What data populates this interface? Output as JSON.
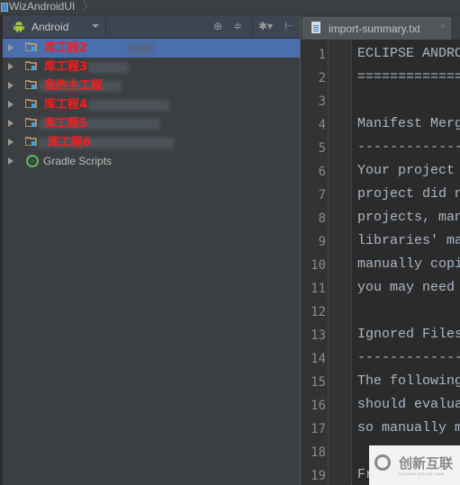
{
  "window": {
    "title": "WizAndroidUI"
  },
  "project_panel": {
    "view_selector": "Android",
    "toolbar_icons": [
      "crosshair-icon",
      "collapse-all-icon",
      "gear-icon",
      "hide-panel-icon"
    ],
    "items": [
      {
        "label": "库工程2",
        "type": "module",
        "selected": true
      },
      {
        "label": "库工程3",
        "type": "module",
        "selected": false
      },
      {
        "label": "我的主工程",
        "type": "module",
        "selected": false
      },
      {
        "label": "库工程4",
        "type": "module",
        "selected": false
      },
      {
        "label": "库工程5",
        "type": "module",
        "selected": false
      },
      {
        "label": "库工程6",
        "type": "module",
        "selected": false
      },
      {
        "label": "Gradle Scripts",
        "type": "gradle",
        "selected": false
      }
    ]
  },
  "editor": {
    "tab": {
      "label": "import-summary.txt",
      "close": "×"
    },
    "lines": [
      {
        "n": "1",
        "text": "ECLIPSE ANDRO"
      },
      {
        "n": "2",
        "text": "============="
      },
      {
        "n": "3",
        "text": ""
      },
      {
        "n": "4",
        "text": "Manifest Merg"
      },
      {
        "n": "5",
        "text": "-------------"
      },
      {
        "n": "6",
        "text": "Your project "
      },
      {
        "n": "7",
        "text": "project did n"
      },
      {
        "n": "8",
        "text": "projects, man"
      },
      {
        "n": "9",
        "text": "libraries' ma"
      },
      {
        "n": "10",
        "text": "manually copi"
      },
      {
        "n": "11",
        "text": "you may need "
      },
      {
        "n": "12",
        "text": ""
      },
      {
        "n": "13",
        "text": "Ignored Files"
      },
      {
        "n": "14",
        "text": "-------------"
      },
      {
        "n": "15",
        "text": "The following"
      },
      {
        "n": "16",
        "text": "should evalua"
      },
      {
        "n": "17",
        "text": "so manually m"
      },
      {
        "n": "18",
        "text": ""
      },
      {
        "n": "19",
        "text": "Fr"
      }
    ]
  },
  "watermark": {
    "text": "创新互联",
    "subtext": "CHUANG XIN HU LIAN"
  }
}
